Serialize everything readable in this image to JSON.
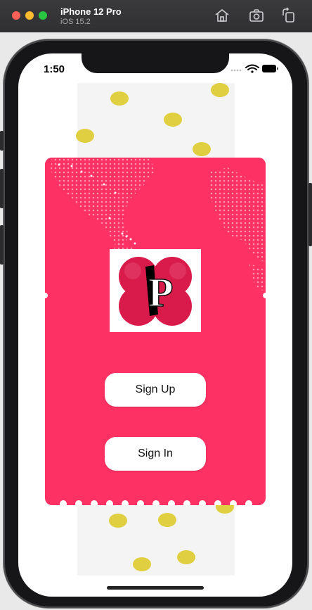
{
  "simulator": {
    "device_name": "iPhone 12 Pro",
    "os_version": "iOS 15.2",
    "toolbar_icons": [
      "home-icon",
      "screenshot-icon",
      "rotate-icon"
    ]
  },
  "status_bar": {
    "time": "1:50",
    "icons": [
      "wifi-icon",
      "battery-icon"
    ]
  },
  "app": {
    "logo_letter": "P",
    "buttons": {
      "sign_up_label": "Sign Up",
      "sign_in_label": "Sign In"
    }
  },
  "colors": {
    "primary": "#fd3163",
    "button_bg": "#ffffff",
    "dot_color": "#e0cf40"
  }
}
